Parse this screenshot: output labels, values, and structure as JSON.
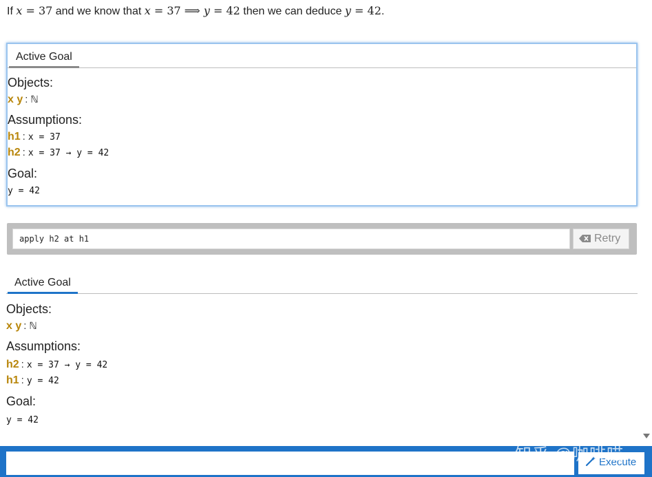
{
  "intro": {
    "prefix": "If ",
    "var_x": "x",
    "eq": " = ",
    "val_37": "37",
    "mid": " and we know that ",
    "implies": " ⟹ ",
    "var_y": "y",
    "val_42": "42",
    "tail": " then we can deduce ",
    "end": "."
  },
  "goal1": {
    "tab_label": "Active Goal",
    "objects_title": "Objects:",
    "objects": {
      "names": "x y",
      "colon": ":",
      "type": "ℕ"
    },
    "assumptions_title": "Assumptions:",
    "assumptions": [
      {
        "name": "h1",
        "expr": "x = 37"
      },
      {
        "name": "h2",
        "expr": "x = 37 → y = 42"
      }
    ],
    "goal_title": "Goal:",
    "goal_expr": "y = 42"
  },
  "command": {
    "value": "apply h2 at h1",
    "retry_label": "Retry"
  },
  "goal2": {
    "tab_label": "Active Goal",
    "objects_title": "Objects:",
    "objects": {
      "names": "x y",
      "colon": ":",
      "type": "ℕ"
    },
    "assumptions_title": "Assumptions:",
    "assumptions": [
      {
        "name": "h2",
        "expr": "x = 37 → y = 42"
      },
      {
        "name": "h1",
        "expr": "y = 42"
      }
    ],
    "goal_title": "Goal:",
    "goal_expr": "y = 42"
  },
  "bottom": {
    "input_value": "",
    "execute_label": "Execute"
  },
  "watermark": "知乎 @咖啡喵",
  "colors": {
    "accent": "#1e73c8",
    "hypothesis": "#b8860b",
    "focus_border": "#9ac4ee"
  }
}
